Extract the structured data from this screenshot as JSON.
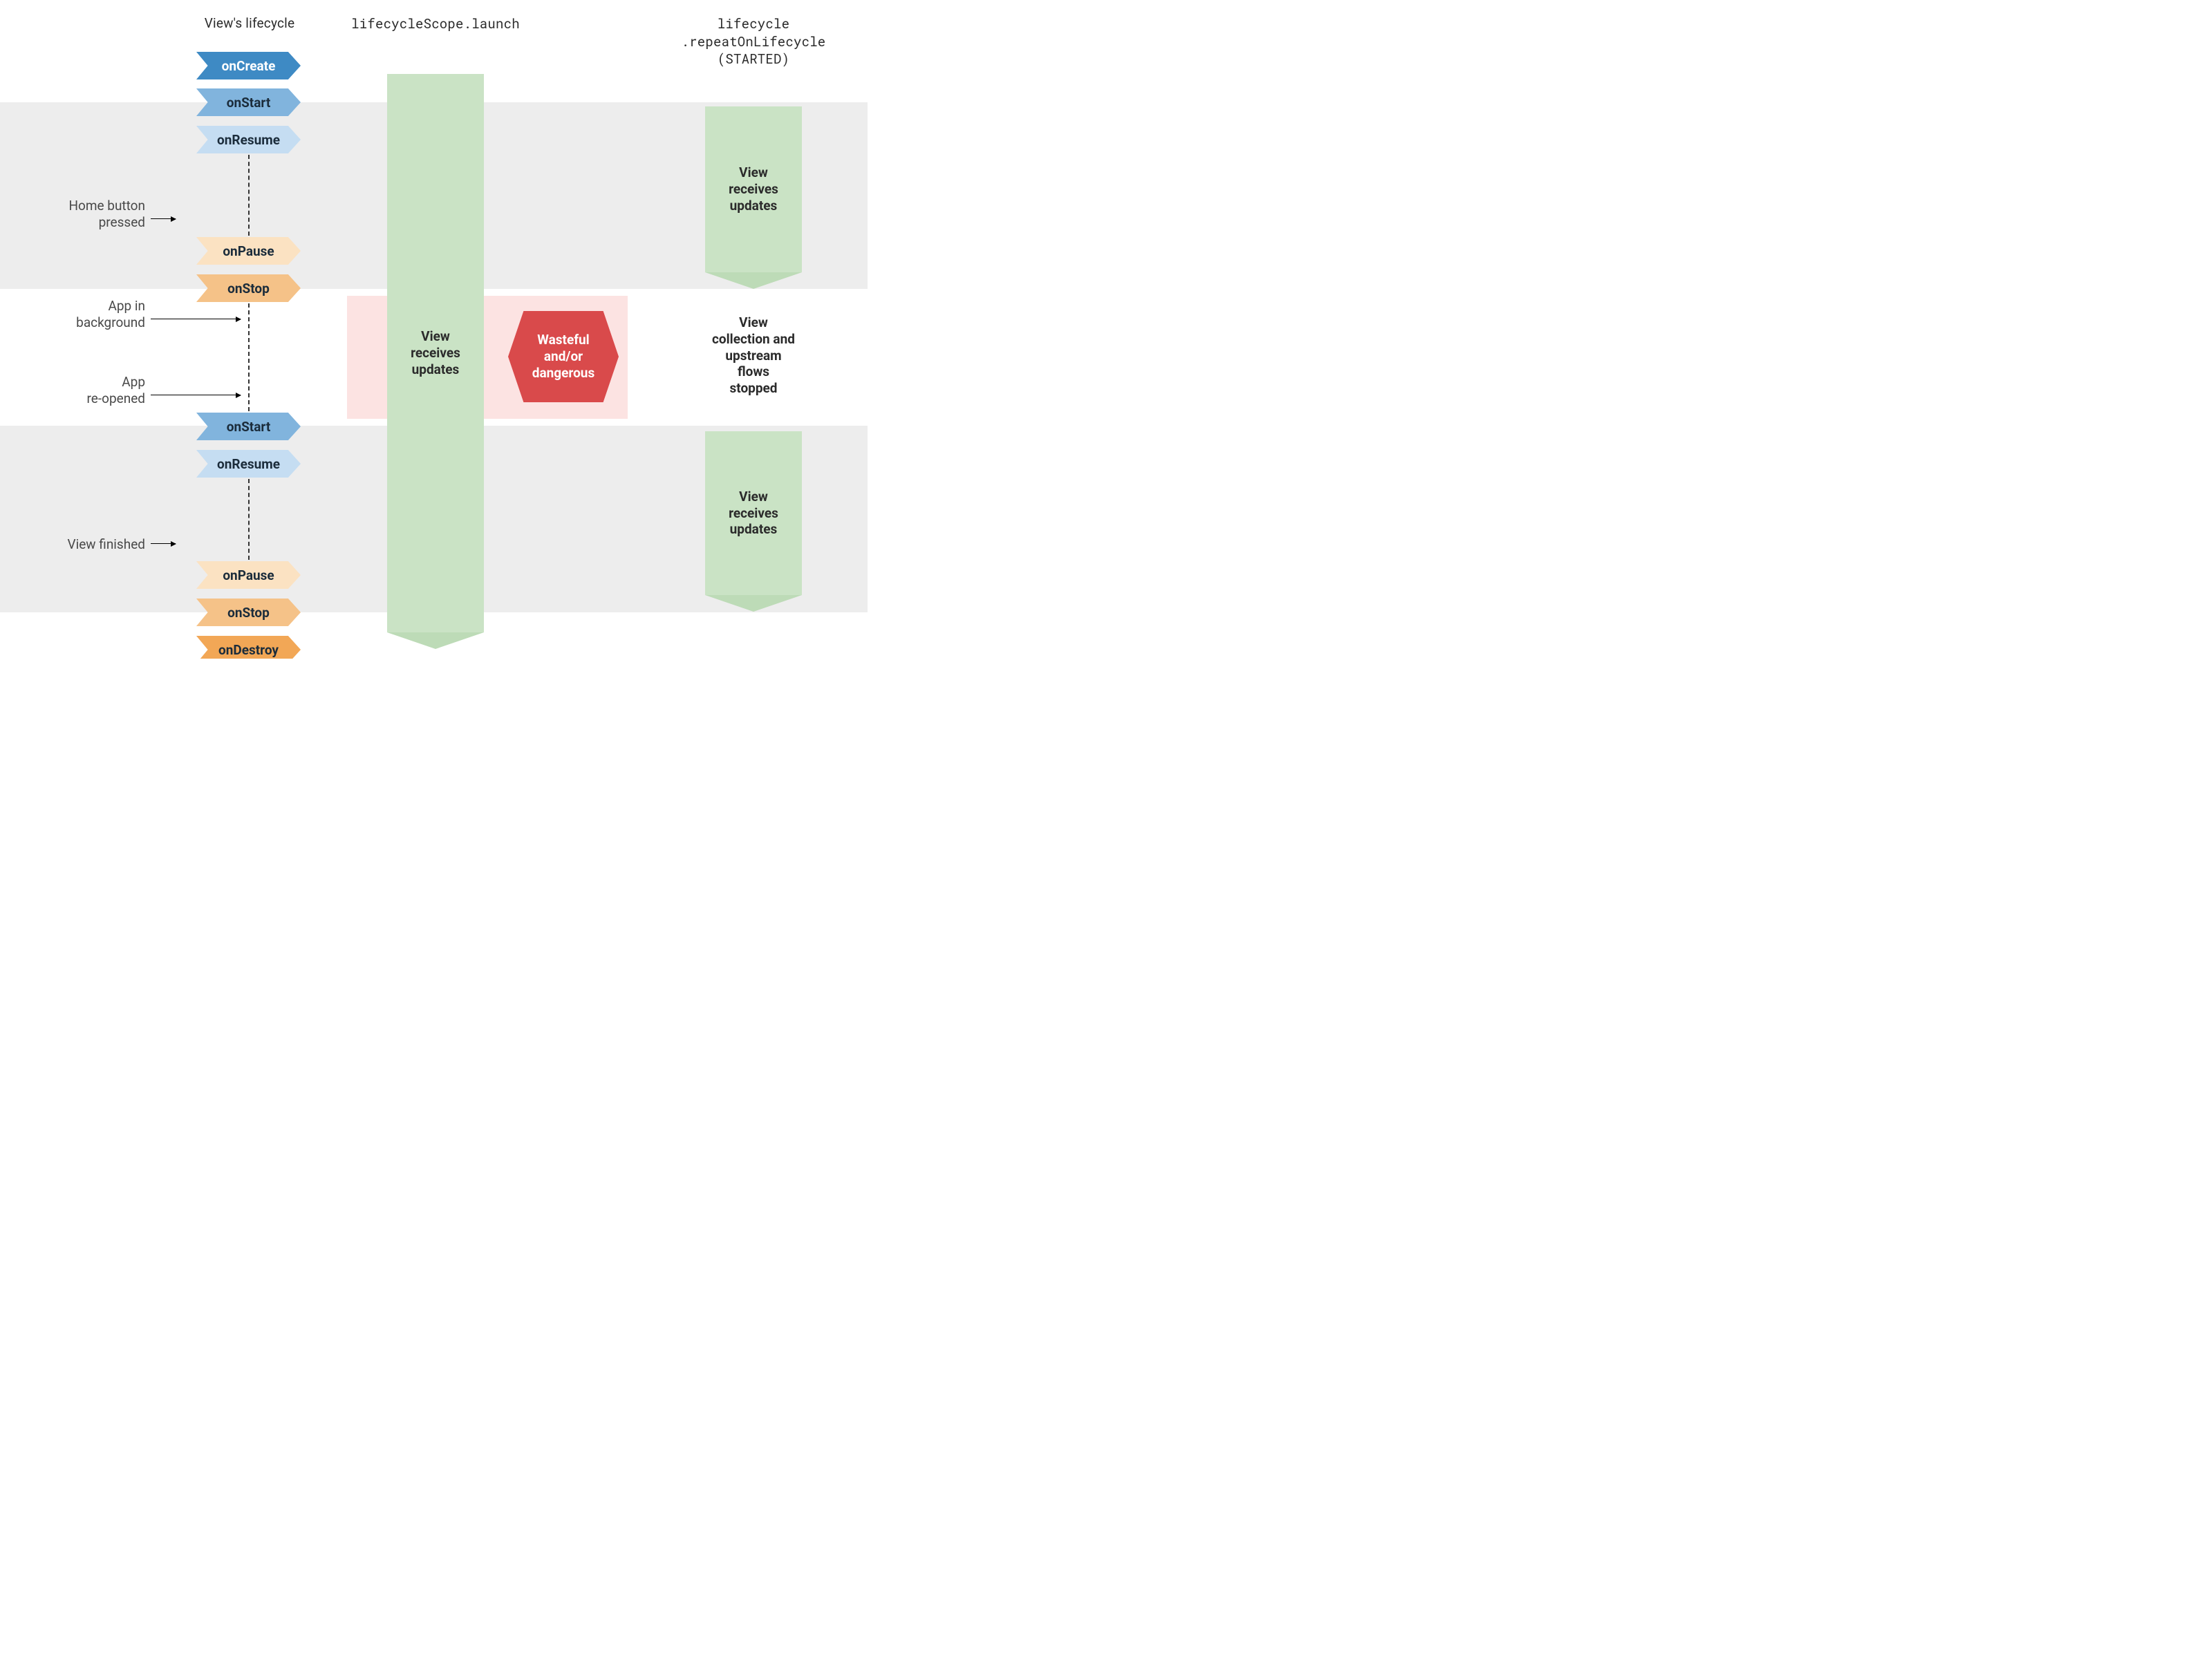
{
  "headers": {
    "lifecycle": "View's lifecycle",
    "launch": "lifecycleScope.launch",
    "repeat": "lifecycle\n.repeatOnLifecycle\n(STARTED)"
  },
  "lifecycle_nodes": {
    "onCreate": "onCreate",
    "onStart1": "onStart",
    "onResume1": "onResume",
    "onPause1": "onPause",
    "onStop1": "onStop",
    "onStart2": "onStart",
    "onResume2": "onResume",
    "onPause2": "onPause",
    "onStop2": "onStop",
    "onDestroy": "onDestroy"
  },
  "side_labels": {
    "home": "Home button\npressed",
    "background": "App in\nbackground",
    "reopened": "App\nre-opened",
    "finished": "View finished"
  },
  "center": {
    "view_receives": "View\nreceives\nupdates",
    "wasteful": "Wasteful\nand/or\ndangerous"
  },
  "right": {
    "receives_top": "View\nreceives\nupdates",
    "stopped": "View\ncollection and\nupstream\nflows\nstopped",
    "receives_bottom": "View\nreceives\nupdates"
  },
  "colors": {
    "onCreate": "#3e8ac4",
    "onStart": "#81b4dd",
    "onResume": "#c5ddf2",
    "onPause": "#fbe2c2",
    "onStop": "#f5c288",
    "onDestroy": "#f2a756"
  }
}
